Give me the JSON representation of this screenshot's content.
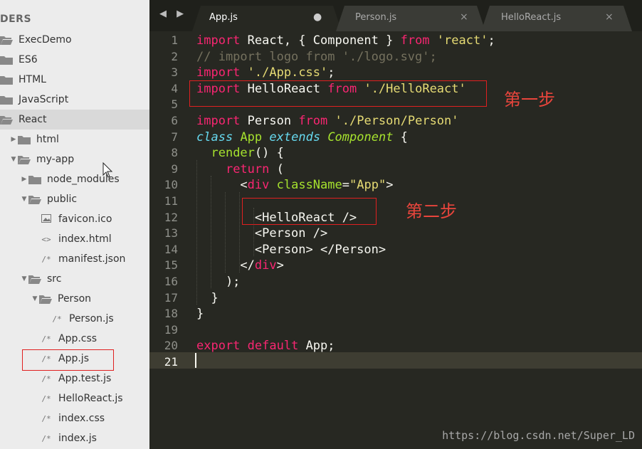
{
  "sidebar": {
    "header": "DERS",
    "items": [
      {
        "label": "ExecDemo",
        "kind": "folder-open",
        "depth": 0
      },
      {
        "label": "ES6",
        "kind": "folder",
        "depth": 0
      },
      {
        "label": "HTML",
        "kind": "folder",
        "depth": 0
      },
      {
        "label": "JavaScript",
        "kind": "folder",
        "depth": 0
      },
      {
        "label": "React",
        "kind": "folder-open",
        "depth": 0,
        "selected": true
      },
      {
        "label": "html",
        "kind": "folder",
        "depth": 1
      },
      {
        "label": "my-app",
        "kind": "folder-open",
        "depth": 1
      },
      {
        "label": "node_modules",
        "kind": "folder",
        "depth": 2
      },
      {
        "label": "public",
        "kind": "folder-open",
        "depth": 2
      },
      {
        "label": "favicon.ico",
        "kind": "image-file",
        "icon": "image-file-icon",
        "depth": 3
      },
      {
        "label": "index.html",
        "kind": "html-file",
        "icon": "<>",
        "depth": 3
      },
      {
        "label": "manifest.json",
        "kind": "file",
        "icon": "/*",
        "depth": 3
      },
      {
        "label": "src",
        "kind": "folder-open",
        "depth": 2
      },
      {
        "label": "Person",
        "kind": "folder-open",
        "depth": 3
      },
      {
        "label": "Person.js",
        "kind": "file",
        "icon": "/*",
        "depth": 4
      },
      {
        "label": "App.css",
        "kind": "file",
        "icon": "/*",
        "depth": 3
      },
      {
        "label": "App.js",
        "kind": "file",
        "icon": "/*",
        "depth": 3,
        "highlighted": true
      },
      {
        "label": "App.test.js",
        "kind": "file",
        "icon": "/*",
        "depth": 3
      },
      {
        "label": "HelloReact.js",
        "kind": "file",
        "icon": "/*",
        "depth": 3
      },
      {
        "label": "index.css",
        "kind": "file",
        "icon": "/*",
        "depth": 3
      },
      {
        "label": "index.js",
        "kind": "file",
        "icon": "/*",
        "depth": 3
      }
    ]
  },
  "tabs": [
    {
      "label": "App.js",
      "active": true,
      "control": "●"
    },
    {
      "label": "Person.js",
      "active": false,
      "control": "×"
    },
    {
      "label": "HelloReact.js",
      "active": false,
      "control": "×"
    }
  ],
  "nav_arrows": "◀ ▶",
  "editor": {
    "line_numbers": [
      "1",
      "2",
      "3",
      "4",
      "5",
      "6",
      "7",
      "8",
      "9",
      "10",
      "11",
      "12",
      "13",
      "14",
      "15",
      "16",
      "17",
      "18",
      "19",
      "20",
      "21"
    ],
    "active_line": "21"
  },
  "annotations": {
    "step_one": "第一步",
    "step_two": "第二步"
  },
  "watermark": "https://blog.csdn.net/Super_LD",
  "colors": {
    "editor_bg": "#272822",
    "keyword": "#f92672",
    "string": "#e6db74",
    "comment": "#75715e",
    "class_kw": "#66d9ef",
    "entity": "#a6e22e",
    "annotation_red": "#e02020",
    "sidebar_bg": "#ececec"
  }
}
